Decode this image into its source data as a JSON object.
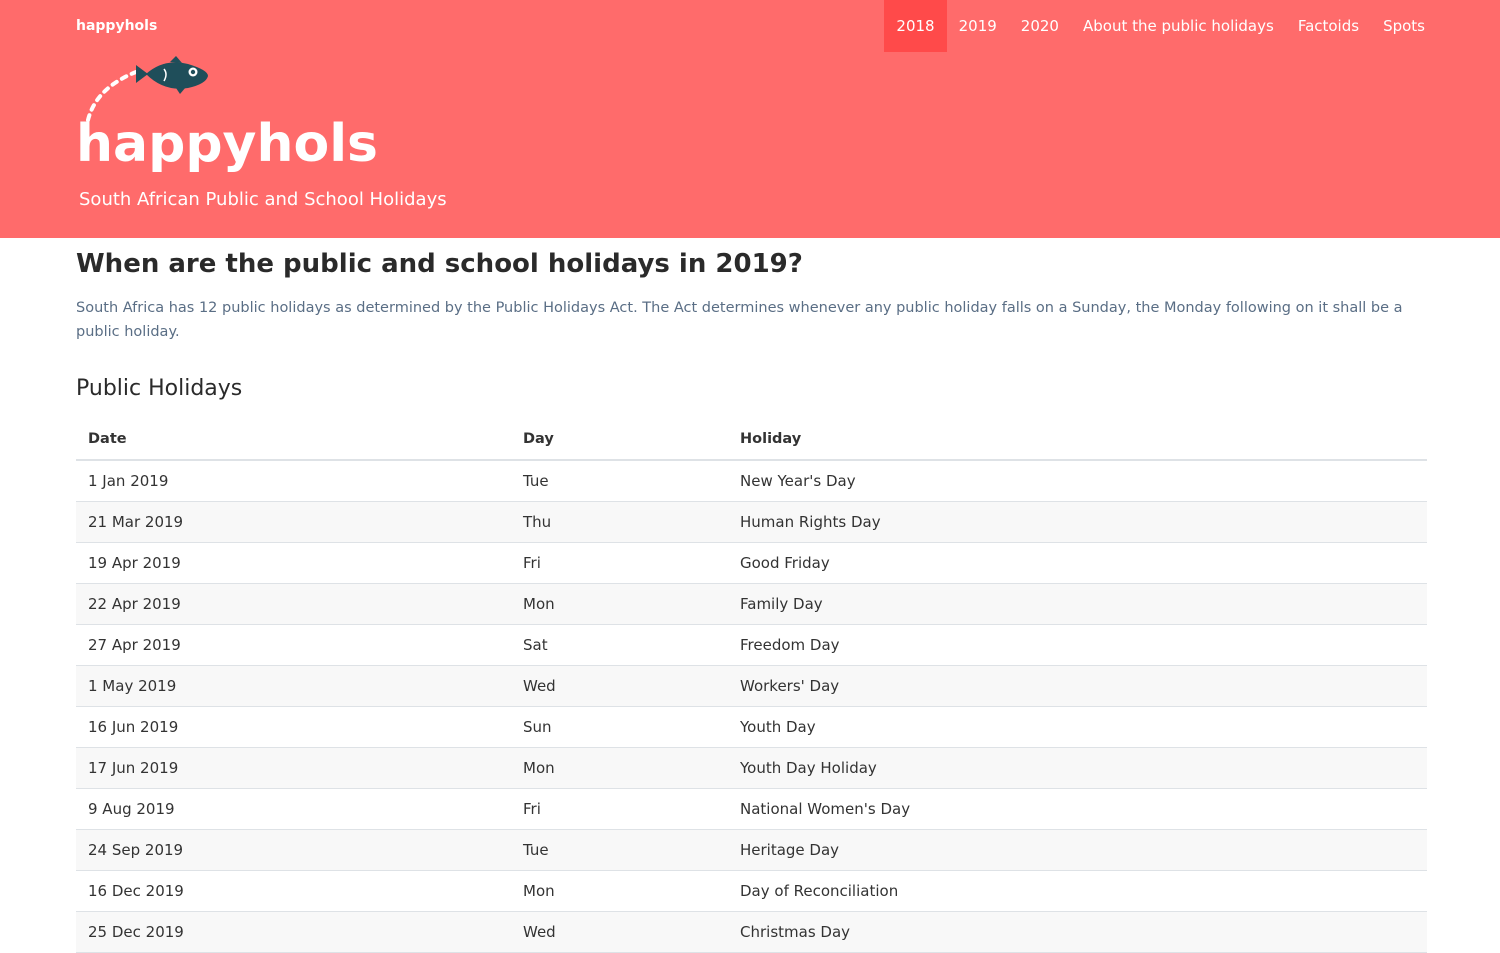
{
  "brand": "happyhols",
  "nav": {
    "items": [
      {
        "label": "2018",
        "active": true
      },
      {
        "label": "2019",
        "active": false
      },
      {
        "label": "2020",
        "active": false
      },
      {
        "label": "About the public holidays",
        "active": false
      },
      {
        "label": "Factoids",
        "active": false
      },
      {
        "label": "Spots",
        "active": false
      }
    ]
  },
  "hero": {
    "logo_text": "happyhols",
    "logo_icon": "fish-icon",
    "tagline": "South African Public and School Holidays"
  },
  "main": {
    "title": "When are the public and school holidays in 2019?",
    "intro": "South Africa has 12 public holidays as determined by the Public Holidays Act. The Act determines whenever any public holiday falls on a Sunday, the Monday following on it shall be a public holiday.",
    "section_title": "Public Holidays"
  },
  "table": {
    "headers": [
      "Date",
      "Day",
      "Holiday"
    ],
    "rows": [
      [
        "1 Jan 2019",
        "Tue",
        "New Year's Day"
      ],
      [
        "21 Mar 2019",
        "Thu",
        "Human Rights Day"
      ],
      [
        "19 Apr 2019",
        "Fri",
        "Good Friday"
      ],
      [
        "22 Apr 2019",
        "Mon",
        "Family Day"
      ],
      [
        "27 Apr 2019",
        "Sat",
        "Freedom Day"
      ],
      [
        "1 May 2019",
        "Wed",
        "Workers' Day"
      ],
      [
        "16 Jun 2019",
        "Sun",
        "Youth Day"
      ],
      [
        "17 Jun 2019",
        "Mon",
        "Youth Day Holiday"
      ],
      [
        "9 Aug 2019",
        "Fri",
        "National Women's Day"
      ],
      [
        "24 Sep 2019",
        "Tue",
        "Heritage Day"
      ],
      [
        "16 Dec 2019",
        "Mon",
        "Day of Reconciliation"
      ],
      [
        "25 Dec 2019",
        "Wed",
        "Christmas Day"
      ]
    ]
  },
  "colors": {
    "header_bg": "#ff6b6b",
    "nav_active_bg": "#ff4a4a",
    "fish": "#1f4e5a",
    "intro_text": "#5a6e85"
  }
}
